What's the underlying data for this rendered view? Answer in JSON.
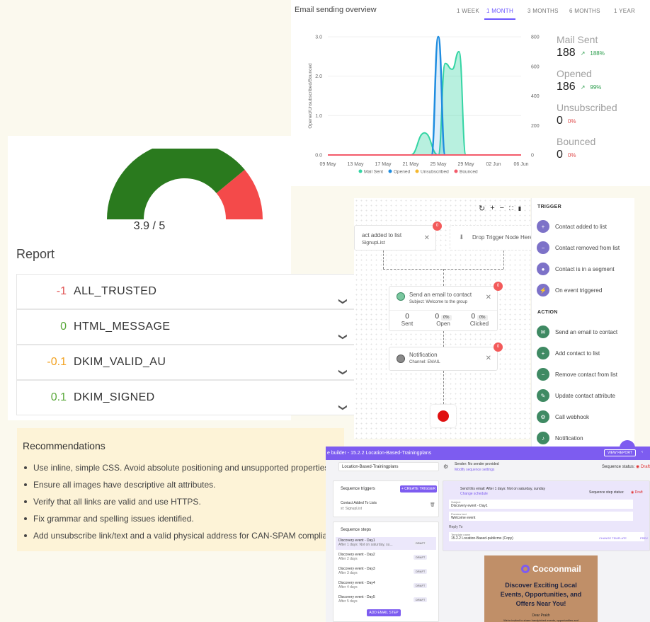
{
  "overview": {
    "title": "Email sending overview",
    "ranges": [
      "1 WEEK",
      "1 MONTH",
      "3 MONTHS",
      "6 MONTHS",
      "1 YEAR"
    ],
    "active_range": "1 MONTH",
    "stats": [
      {
        "label": "Mail Sent",
        "value": "188",
        "trend": "188%",
        "trend_dir": "up"
      },
      {
        "label": "Opened",
        "value": "186",
        "trend": "99%",
        "trend_dir": "up"
      },
      {
        "label": "Unsubscribed",
        "value": "0",
        "trend": "0%",
        "trend_dir": "none"
      },
      {
        "label": "Bounced",
        "value": "0",
        "trend": "0%",
        "trend_dir": "none"
      }
    ]
  },
  "chart_data": {
    "type": "line",
    "ylabel_left": "Opened/Unsubscribed/Bounced",
    "x_ticks": [
      "09 May",
      "13 May",
      "17 May",
      "21 May",
      "25 May",
      "29 May",
      "02 Jun",
      "06 Jun"
    ],
    "y_left_ticks": [
      "0.0",
      "1.0",
      "2.0",
      "3.0"
    ],
    "y_right_ticks": [
      "0",
      "200",
      "400",
      "600",
      "800"
    ],
    "ylim_left": [
      0,
      3
    ],
    "ylim_right": [
      0,
      800
    ],
    "legend": [
      "Mail Sent",
      "Opened",
      "Unsubscribed",
      "Bounced"
    ],
    "colors": {
      "mail_sent": "#35d5a4",
      "opened": "#1f8de0",
      "unsubscribed": "#f5b82e",
      "bounced": "#f35a6a"
    },
    "series": [
      {
        "name": "Mail Sent",
        "axis": "right",
        "x": [
          "21 May",
          "23 May",
          "25 May",
          "26 May",
          "27 May",
          "28 May",
          "29 May"
        ],
        "values": [
          0,
          150,
          0,
          620,
          580,
          700,
          0
        ]
      },
      {
        "name": "Opened",
        "axis": "left",
        "x": [
          "24 May",
          "25 May",
          "26 May"
        ],
        "values": [
          0,
          3.0,
          0
        ]
      },
      {
        "name": "Unsubscribed",
        "axis": "left",
        "x": [
          "09 May",
          "06 Jun"
        ],
        "values": [
          0,
          0
        ]
      },
      {
        "name": "Bounced",
        "axis": "left",
        "x": [
          "09 May",
          "06 Jun"
        ],
        "values": [
          0,
          0
        ]
      }
    ]
  },
  "report": {
    "score": "3.9 / 5",
    "score_value": 3.9,
    "score_max": 5,
    "title": "Report",
    "rows": [
      {
        "score": "-1",
        "name": "ALL_TRUSTED",
        "color": "#e05050"
      },
      {
        "score": "0",
        "name": "HTML_MESSAGE",
        "color": "#5aa83a"
      },
      {
        "score": "-0.1",
        "name": "DKIM_VALID_AU",
        "color": "#f2a11f"
      },
      {
        "score": "0.1",
        "name": "DKIM_SIGNED",
        "color": "#5aa83a"
      }
    ]
  },
  "recommendations": {
    "title": "Recommendations",
    "items": [
      "Use inline, simple CSS. Avoid absolute positioning and unsupported properties.",
      "Ensure all images have descriptive alt attributes.",
      "Verify that all links are valid and use HTTPS.",
      "Fix grammar and spelling issues identified.",
      "Add unsubscribe link/text and a valid physical address for CAN-SPAM compliance."
    ]
  },
  "flow": {
    "node1_title": "act added to list",
    "node1_sub": "SignupList",
    "node1_badge": "0",
    "drop_label": "Drop Trigger Node Here",
    "node2_title": "Send an email to contact",
    "node2_sub": "Subject: Welcome to the group",
    "node2_badge": "0",
    "node2_stats": [
      {
        "n": "0",
        "pct": "",
        "label": "Sent"
      },
      {
        "n": "0",
        "pct": "0%",
        "label": "Open"
      },
      {
        "n": "0",
        "pct": "0%",
        "label": "Clicked"
      }
    ],
    "node3_title": "Notification",
    "node3_sub": "Channel: EMAIL",
    "node3_badge": "0"
  },
  "sidebar": {
    "trigger_heading": "TRIGGER",
    "triggers": [
      "Contact added to list",
      "Contact removed from list",
      "Contact is in a segment",
      "On event triggered"
    ],
    "action_heading": "ACTION",
    "actions": [
      "Send an email to contact",
      "Add contact to list",
      "Remove contact from list",
      "Update contact attribute",
      "Call webhook",
      "Notification"
    ]
  },
  "sequence": {
    "title": "e builder - 15.2.2 Location-Based-Trainingplans",
    "view_report": "VIEW REPORT",
    "name_value": "Location-Based-Trainingplans",
    "sender": "Sender: No sender provided",
    "modify": "Modify sequence settings",
    "status_label": "Sequence status:",
    "status_value": "Draft",
    "triggers_heading": "Sequence triggers",
    "create_trigger": "+ CREATE TRIGGER",
    "trigger_item": "Contact Added To Lists",
    "trigger_item_sub": "st: SignupList",
    "steps_heading": "Sequence steps",
    "steps": [
      {
        "name": "Discovery event - Day1",
        "sub": "After 1 days: Not on saturday, su...",
        "status": "DRAFT"
      },
      {
        "name": "Discovery event - Day2",
        "sub": "After 2 days",
        "status": "DRAFT"
      },
      {
        "name": "Discovery event - Day3",
        "sub": "After 3 days",
        "status": "DRAFT"
      },
      {
        "name": "Discovery event - Day4",
        "sub": "After 4 days",
        "status": "DRAFT"
      },
      {
        "name": "Discovery event - Day5",
        "sub": "After 5 days",
        "status": "DRAFT"
      }
    ],
    "add_step": "ADD EMAIL STEP",
    "send_rule": "Send this email: After 1 days: Not on saturday, sunday",
    "change_schedule": "Change schedule",
    "step_status_label": "Sequence step status:",
    "step_status_value": "Draft",
    "subject_label": "Subject",
    "subject_value": "Discovery event - Day1",
    "preview_label": "Preview text",
    "preview_value": "Welcome event",
    "reply_to": "Reply To",
    "template_label": "Template name",
    "template_value": "15.2.2 Location-Based-publicms (Copy)",
    "change_template": "CHANGE TEMPLATE",
    "prev": "PREV",
    "brand": "Cocoonmail",
    "email_heading": "Discover Exciting Local Events, Opportunities, and Offers Near You!",
    "email_greeting": "Dear Prakh",
    "email_body": "We're invited to share handpicked events, opportunities and"
  }
}
